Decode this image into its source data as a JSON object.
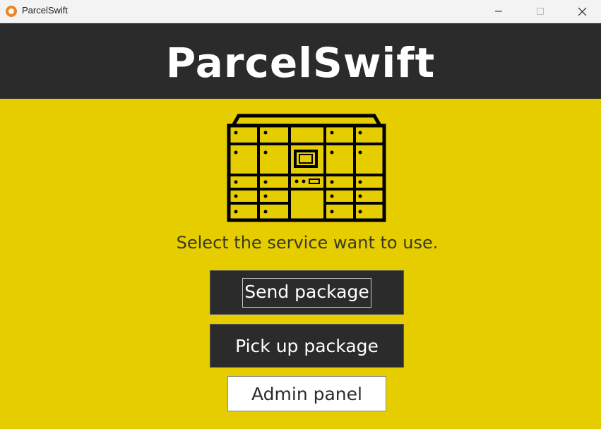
{
  "window": {
    "title": "ParcelSwift",
    "controls": [
      "minimize-icon",
      "maximize-icon",
      "close-icon"
    ]
  },
  "header": {
    "title": "ParcelSwift"
  },
  "illustration": {
    "icon": "parcel-locker-icon"
  },
  "main": {
    "prompt": "Select the service want to use.",
    "buttons": {
      "send": "Send package",
      "pickup": "Pick up package",
      "admin": "Admin panel"
    }
  },
  "colors": {
    "background": "#e6cd00",
    "header": "#2b2b2b",
    "button_dark": "#2b2b2b",
    "button_light": "#ffffff"
  }
}
